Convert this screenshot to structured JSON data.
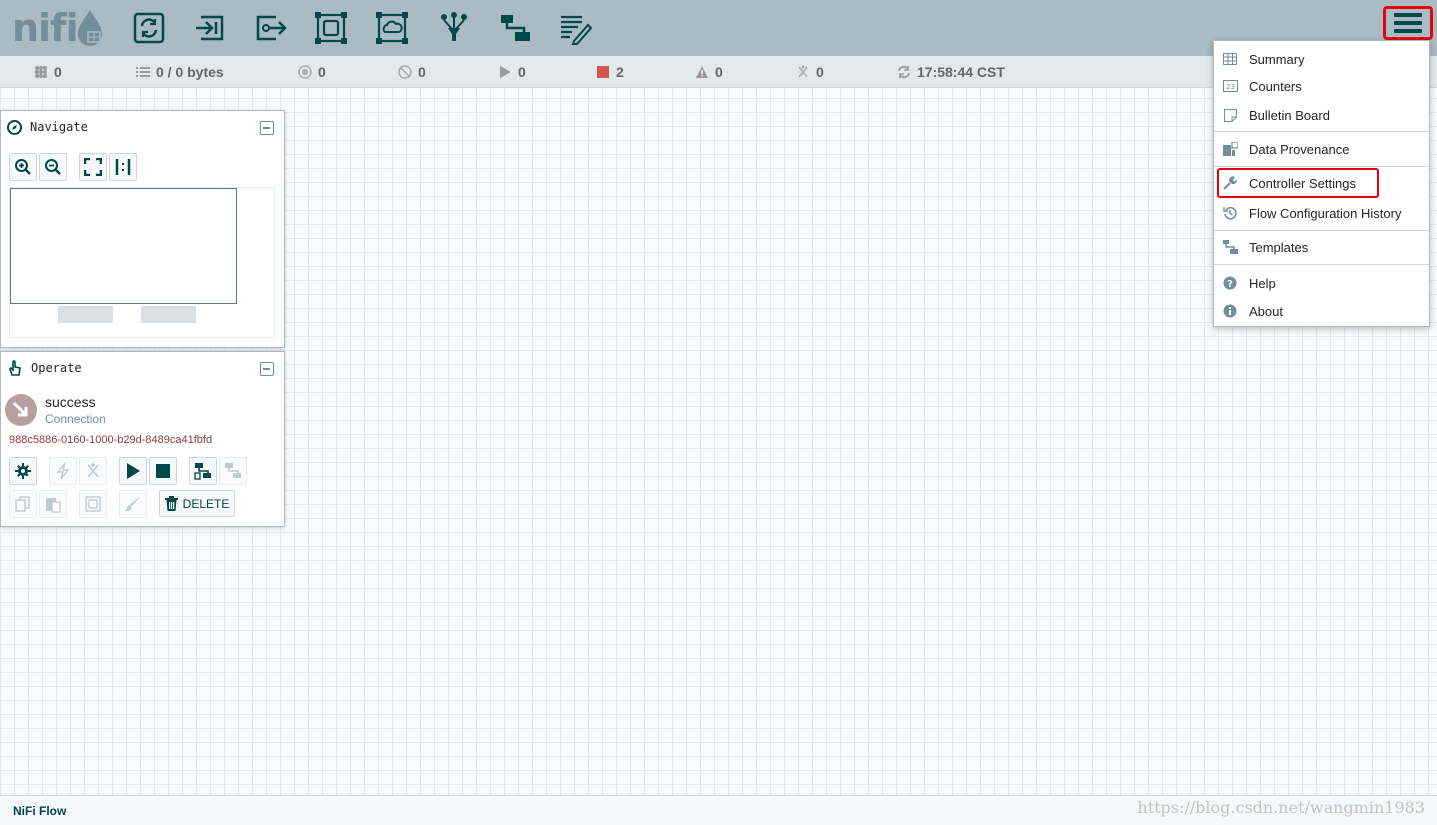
{
  "app": {
    "logo_text": "nifi"
  },
  "toolbar": {
    "components": [
      {
        "name": "processor-icon"
      },
      {
        "name": "input-port-icon"
      },
      {
        "name": "output-port-icon"
      },
      {
        "name": "process-group-icon"
      },
      {
        "name": "remote-process-group-icon"
      },
      {
        "name": "funnel-icon"
      },
      {
        "name": "template-icon"
      },
      {
        "name": "label-icon"
      }
    ]
  },
  "status": {
    "active_threads": "0",
    "queued": "0 / 0 bytes",
    "transmitting": "0",
    "not_transmitting": "0",
    "running": "0",
    "stopped": "2",
    "invalid": "0",
    "disabled": "0",
    "last_refreshed": "17:58:44 CST",
    "stopped_color": "#d9534f"
  },
  "navigate": {
    "title": "Navigate"
  },
  "operate": {
    "title": "Operate",
    "selection_name": "success",
    "selection_type": "Connection",
    "selection_id": "988c5886-0160-1000-b29d-8489ca41fbfd",
    "delete_label": "DELETE"
  },
  "menu": {
    "items": [
      {
        "label": "Summary"
      },
      {
        "label": "Counters"
      },
      {
        "label": "Bulletin Board"
      },
      {
        "label": "Data Provenance"
      },
      {
        "label": "Controller Settings"
      },
      {
        "label": "Flow Configuration History"
      },
      {
        "label": "Templates"
      },
      {
        "label": "Help"
      },
      {
        "label": "About"
      }
    ]
  },
  "footer": {
    "breadcrumb": "NiFi Flow",
    "watermark": "https://blog.csdn.net/wangmin1983"
  },
  "colors": {
    "header_bg": "#aabbc3",
    "icon_dark": "#004849",
    "highlight": "#e8000b"
  }
}
